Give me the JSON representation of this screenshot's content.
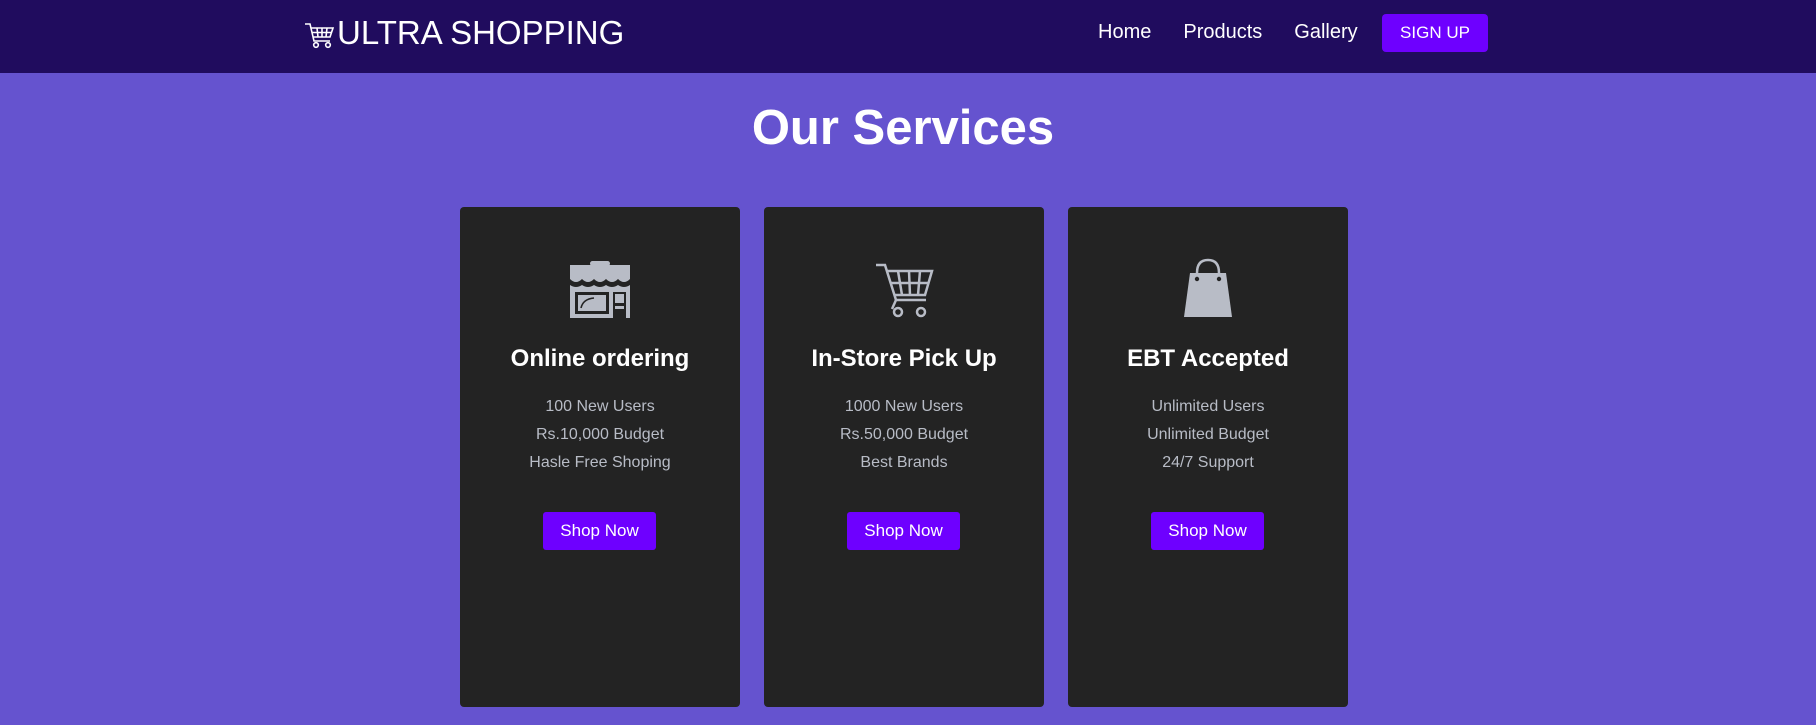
{
  "navbar": {
    "logo_text": "ULTRA SHOPPING",
    "logo_icon": "shopping-cart-icon",
    "links": [
      "Home",
      "Products",
      "Gallery"
    ],
    "signup_label": "SIGN UP"
  },
  "page": {
    "title": "Our Services"
  },
  "services": [
    {
      "icon": "store-icon",
      "title": "Online ordering",
      "lines": [
        "100 New Users",
        "Rs.10,000 Budget",
        "Hasle Free Shoping"
      ],
      "button": "Shop Now"
    },
    {
      "icon": "shopping-cart-icon",
      "title": "In-Store Pick Up",
      "lines": [
        "1000 New Users",
        "Rs.50,000 Budget",
        "Best Brands"
      ],
      "button": "Shop Now"
    },
    {
      "icon": "shopping-bag-icon",
      "title": "EBT Accepted",
      "lines": [
        "Unlimited Users",
        "Unlimited Budget",
        "24/7 Support"
      ],
      "button": "Shop Now"
    }
  ],
  "colors": {
    "navbar_bg": "#200c5e",
    "page_bg": "#6553cf",
    "card_bg": "#232323",
    "accent": "#6e00ff",
    "icon": "#b8bcc6"
  }
}
